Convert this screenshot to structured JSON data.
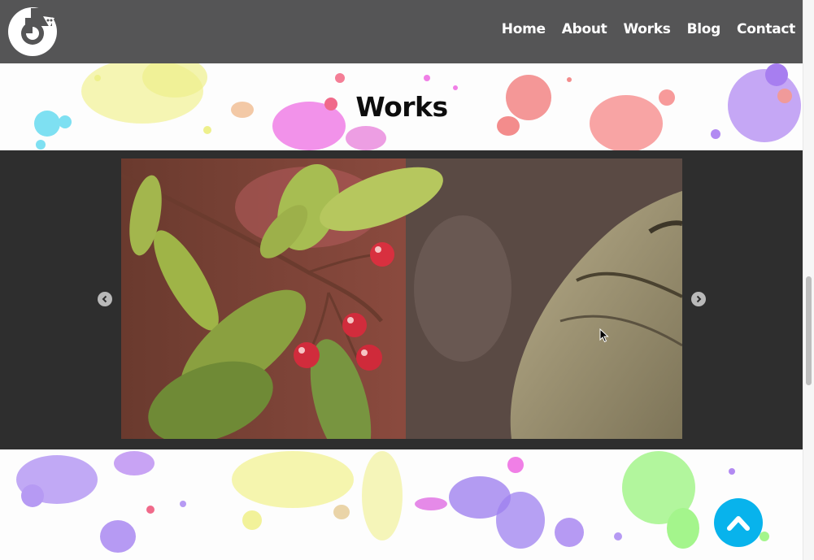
{
  "header": {
    "logo_icon": "circular-arrow-logo-icon",
    "nav": [
      {
        "label": "Home"
      },
      {
        "label": "About"
      },
      {
        "label": "Works"
      },
      {
        "label": "Blog"
      },
      {
        "label": "Contact"
      }
    ]
  },
  "section": {
    "title": "Works"
  },
  "carousel": {
    "slide_image": "berries-on-branch-photo",
    "prev_icon": "chevron-left-icon",
    "next_icon": "chevron-right-icon"
  },
  "back_to_top": {
    "icon": "chevron-up-icon"
  },
  "colors": {
    "header_bg": "#555556",
    "carousel_bg": "#2e2e2e",
    "accent": "#08b3ec"
  }
}
